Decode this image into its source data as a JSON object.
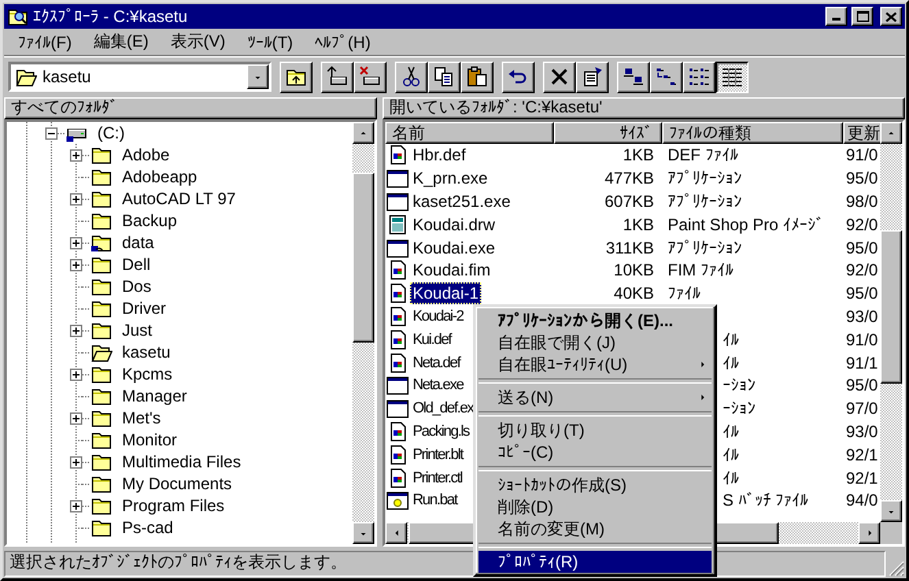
{
  "window": {
    "title": "ｴｸｽﾌﾟﾛｰﾗ - C:¥kasetu"
  },
  "menu_bar": [
    {
      "label": "ﾌｧｲﾙ(F)"
    },
    {
      "label": "編集(E)"
    },
    {
      "label": "表示(V)"
    },
    {
      "label": "ﾂｰﾙ(T)"
    },
    {
      "label": "ﾍﾙﾌﾟ(H)"
    }
  ],
  "toolbar": {
    "address": "kasetu",
    "groups": [
      [
        {
          "kind": "up",
          "pressed": false
        }
      ],
      [
        {
          "kind": "map-drive",
          "pressed": false
        },
        {
          "kind": "disconnect",
          "pressed": false
        }
      ],
      [
        {
          "kind": "cut",
          "pressed": false
        },
        {
          "kind": "copy",
          "pressed": false
        },
        {
          "kind": "paste",
          "pressed": false
        }
      ],
      [
        {
          "kind": "undo",
          "pressed": false
        }
      ],
      [
        {
          "kind": "delete",
          "pressed": false
        },
        {
          "kind": "properties",
          "pressed": false
        }
      ],
      [
        {
          "kind": "large-icons",
          "pressed": false
        },
        {
          "kind": "small-icons",
          "pressed": false
        },
        {
          "kind": "list",
          "pressed": false
        },
        {
          "kind": "details",
          "pressed": true
        }
      ]
    ]
  },
  "tree_header": "すべてのﾌｫﾙﾀﾞ",
  "list_header": "開いているﾌｫﾙﾀﾞ: 'C:¥kasetu'",
  "tree": [
    {
      "label": "(C:)",
      "kind": "drive",
      "expandable": true,
      "expanded": true,
      "children": [
        {
          "label": "Adobe",
          "kind": "folder",
          "expandable": true,
          "expanded": false
        },
        {
          "label": "Adobeapp",
          "kind": "folder",
          "expandable": false
        },
        {
          "label": "AutoCAD LT 97",
          "kind": "folder",
          "expandable": true,
          "expanded": false
        },
        {
          "label": "Backup",
          "kind": "folder",
          "expandable": false
        },
        {
          "label": "data",
          "kind": "shared-folder",
          "expandable": true,
          "expanded": false
        },
        {
          "label": "Dell",
          "kind": "folder",
          "expandable": true,
          "expanded": false
        },
        {
          "label": "Dos",
          "kind": "folder",
          "expandable": false
        },
        {
          "label": "Driver",
          "kind": "folder",
          "expandable": false
        },
        {
          "label": "Just",
          "kind": "folder",
          "expandable": true,
          "expanded": false
        },
        {
          "label": "kasetu",
          "kind": "open-folder",
          "expandable": false
        },
        {
          "label": "Kpcms",
          "kind": "folder",
          "expandable": true,
          "expanded": false
        },
        {
          "label": "Manager",
          "kind": "folder",
          "expandable": false
        },
        {
          "label": "Met's",
          "kind": "folder",
          "expandable": true,
          "expanded": false
        },
        {
          "label": "Monitor",
          "kind": "folder",
          "expandable": false
        },
        {
          "label": "Multimedia Files",
          "kind": "folder",
          "expandable": true,
          "expanded": false
        },
        {
          "label": "My Documents",
          "kind": "folder",
          "expandable": false
        },
        {
          "label": "Program Files",
          "kind": "folder",
          "expandable": true,
          "expanded": false
        },
        {
          "label": "Ps-cad",
          "kind": "folder",
          "expandable": false
        }
      ]
    }
  ],
  "file_list": {
    "columns": [
      "名前",
      "ｻｲｽﾞ",
      "ﾌｧｲﾙの種類",
      "更新"
    ],
    "rows": [
      {
        "kind": "doc",
        "name": "Hbr.def",
        "size": "1KB",
        "type": "DEF ﾌｧｲﾙ",
        "date": "91/0",
        "selected": false,
        "covered": false
      },
      {
        "kind": "app",
        "name": "K_prn.exe",
        "size": "477KB",
        "type": "ｱﾌﾟﾘｹｰｼｮﾝ",
        "date": "95/0",
        "selected": false,
        "covered": false
      },
      {
        "kind": "app",
        "name": "kaset251.exe",
        "size": "607KB",
        "type": "ｱﾌﾟﾘｹｰｼｮﾝ",
        "date": "98/0",
        "selected": false,
        "covered": false
      },
      {
        "kind": "image",
        "name": "Koudai.drw",
        "size": "1KB",
        "type": "Paint Shop Pro ｲﾒｰｼﾞ",
        "date": "92/0",
        "selected": false,
        "covered": false
      },
      {
        "kind": "app",
        "name": "Koudai.exe",
        "size": "311KB",
        "type": "ｱﾌﾟﾘｹｰｼｮﾝ",
        "date": "95/0",
        "selected": false,
        "covered": false
      },
      {
        "kind": "doc",
        "name": "Koudai.fim",
        "size": "10KB",
        "type": "FIM ﾌｧｲﾙ",
        "date": "92/0",
        "selected": false,
        "covered": false
      },
      {
        "kind": "doc",
        "name": "Koudai-1",
        "size": "40KB",
        "type": "ﾌｧｲﾙ",
        "date": "95/0",
        "selected": true,
        "covered": false
      },
      {
        "kind": "doc",
        "name": "Koudai-2",
        "date": "93/0",
        "selected": false,
        "covered": true
      },
      {
        "kind": "doc",
        "name": "Kui.def",
        "type": "ｲﾙ",
        "date": "91/0",
        "selected": false,
        "covered": true
      },
      {
        "kind": "doc",
        "name": "Neta.def",
        "type": "ｲﾙ",
        "date": "91/1",
        "selected": false,
        "covered": true
      },
      {
        "kind": "app",
        "name": "Neta.exe",
        "type": "ｰｼｮﾝ",
        "date": "95/0",
        "selected": false,
        "covered": true
      },
      {
        "kind": "app",
        "name": "Old_def.ex",
        "type": "ｰｼｮﾝ",
        "date": "97/0",
        "selected": false,
        "covered": true
      },
      {
        "kind": "doc",
        "name": "Packing.ls",
        "type": "ｲﾙ",
        "date": "93/0",
        "selected": false,
        "covered": true
      },
      {
        "kind": "doc",
        "name": "Printer.blt",
        "type": "ｲﾙ",
        "date": "92/1",
        "selected": false,
        "covered": true
      },
      {
        "kind": "doc",
        "name": "Printer.ctl",
        "type": "ｲﾙ",
        "date": "92/1",
        "selected": false,
        "covered": true
      },
      {
        "kind": "batch",
        "name": "Run.bat",
        "type": "S ﾊﾞｯﾁ ﾌｧｲﾙ",
        "date": "94/0",
        "selected": false,
        "covered": true
      }
    ]
  },
  "context_menu": [
    {
      "kind": "item",
      "label": "ｱﾌﾟﾘｹｰｼｮﾝから開く(E)...",
      "default": true,
      "submenu": false,
      "selected": false
    },
    {
      "kind": "item",
      "label": "自在眼で開く(J)",
      "default": false,
      "submenu": false,
      "selected": false
    },
    {
      "kind": "item",
      "label": "自在眼ﾕｰﾃｨﾘﾃｨ(U)",
      "default": false,
      "submenu": true,
      "selected": false
    },
    {
      "kind": "separator"
    },
    {
      "kind": "item",
      "label": "送る(N)",
      "default": false,
      "submenu": true,
      "selected": false
    },
    {
      "kind": "separator"
    },
    {
      "kind": "item",
      "label": "切り取り(T)",
      "default": false,
      "submenu": false,
      "selected": false
    },
    {
      "kind": "item",
      "label": "ｺﾋﾟｰ(C)",
      "default": false,
      "submenu": false,
      "selected": false
    },
    {
      "kind": "separator"
    },
    {
      "kind": "item",
      "label": "ｼｮｰﾄｶｯﾄの作成(S)",
      "default": false,
      "submenu": false,
      "selected": false
    },
    {
      "kind": "item",
      "label": "削除(D)",
      "default": false,
      "submenu": false,
      "selected": false
    },
    {
      "kind": "item",
      "label": "名前の変更(M)",
      "default": false,
      "submenu": false,
      "selected": false
    },
    {
      "kind": "separator"
    },
    {
      "kind": "item",
      "label": "ﾌﾟﾛﾊﾟﾃｨ(R)",
      "default": false,
      "submenu": false,
      "selected": true
    }
  ],
  "status_bar": "選択されたｵﾌﾞｼﾞｪｸﾄのﾌﾟﾛﾊﾟﾃｨを表示します。"
}
